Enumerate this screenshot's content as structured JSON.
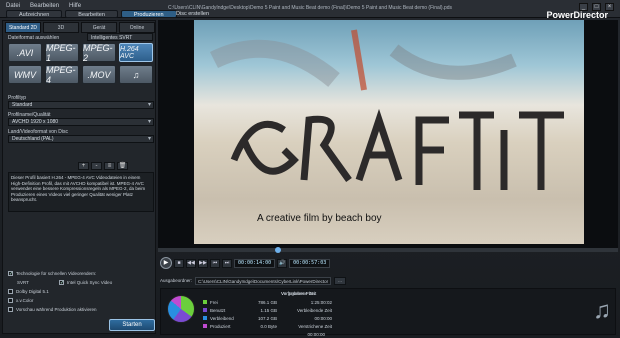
{
  "menu": [
    "Datei",
    "Bearbeiten",
    "Hilfe"
  ],
  "tabs": [
    {
      "label": "Aufzeichnen"
    },
    {
      "label": "Bearbeiten"
    },
    {
      "label": "Produzieren"
    }
  ],
  "filepath": "C:\\Users\\CLIN\\GandyIndge\\Desktop\\Demo 5 Paint and Music Beat demo (Final)\\Demo 5 Paint and Music Beat demo (Final).pds",
  "disc_label": "Disc erstellen",
  "brand": "PowerDirector",
  "left": {
    "subtabs": [
      "Standard 2D",
      "3D",
      "Gerät",
      "Online"
    ],
    "format_label": "Dateiformat auswählen",
    "smart_svrt": "Intelligentes SVRT",
    "formats": [
      ".AVI",
      "MPEG-1",
      "MPEG-2",
      "H.264 AVC",
      "WMV",
      "MPEG-4",
      ".MOV",
      "♫"
    ],
    "profile_label": "Profiltyp",
    "profile_value": "Standard",
    "quality_label": "Profilname/Qualität",
    "quality_value": "AVCHD 1920 x 1080",
    "region_label": "Land/Videoformat von Disc",
    "region_value": "Deutschland (PAL)",
    "description": "Dieser Profil basiert H.264 - MPEG-4 AVC Videodateien in einem High-Definition Profil, das mit AVCHD kompatibel ist. MPEG-4 AVC verwendet eine bessere Kompressionsregeln als MPEG-2, da beim Produzieren eines Videos viel geringer Qualität weniger Platz beansprucht.",
    "desc_tools": [
      "+",
      "-",
      "≡",
      "🗑"
    ],
    "hw_accel": "Technologie für schnellen Videorendern:",
    "svrt_label": "SVRT",
    "intel_label": "Intel Quick Sync Video",
    "dolby": "Dolby Digital 5.1",
    "xvcolor": "x.v.Color",
    "upload": "Vorschau während Produktion aktivieren",
    "start_button": "Starten"
  },
  "viewer": {
    "caption": "A creative film by beach boy",
    "timecode1": "00:00:14:00",
    "timecode2": "00:00:57:03",
    "controls": [
      "■",
      "◀◀",
      "▶▶",
      "⏮",
      "⏭",
      "🔊"
    ]
  },
  "output": {
    "label": "Ausgabeordner:",
    "path": "C:\\Users\\CLIN\\GandyIndge\\Documents\\CyberLink\\PowerDirector",
    "browse": "..."
  },
  "stats": {
    "header": "Verfügbarer Platz",
    "rows": [
      {
        "name": "Frei",
        "size": "786.1 GB",
        "color": "#6bcf3c"
      },
      {
        "name": "Benutzt",
        "size": "1.15 GB",
        "color": "#7a4bd1"
      },
      {
        "name": "Verbleibend",
        "size": "107.2 GB",
        "color": "#2a8fe0"
      },
      {
        "name": "Produziert",
        "size": "0.0 Byte",
        "color": "#c04bd1"
      }
    ],
    "col2_header": "Vorgesehene Zeit",
    "col2": [
      "1:25:00:02",
      "Verbleibende Zeit",
      "00:00:00",
      "Verstrichene Zeit",
      "00:00:00"
    ]
  }
}
